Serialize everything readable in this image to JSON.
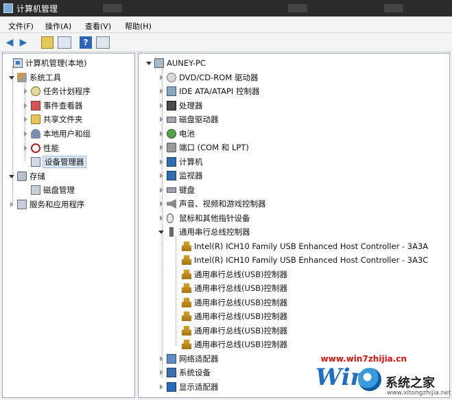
{
  "window": {
    "title": "计算机管理"
  },
  "menu": {
    "items": [
      "文件(F)",
      "操作(A)",
      "查看(V)",
      "帮助(H)"
    ]
  },
  "toolbar": {
    "buttons": [
      "back-arrow-icon",
      "forward-arrow-icon",
      "up-folder-icon",
      "show-hide-tree-icon",
      "help-icon",
      "properties-icon"
    ]
  },
  "left_tree": {
    "root": "计算机管理(本地)",
    "system_tools": "系统工具",
    "task_scheduler": "任务计划程序",
    "event_viewer": "事件查看器",
    "shared_folders": "共享文件夹",
    "local_users": "本地用户和组",
    "performance": "性能",
    "device_manager": "设备管理器",
    "storage": "存储",
    "disk_management": "磁盘管理",
    "services_apps": "服务和应用程序"
  },
  "right_tree": {
    "root": "AUNEY-PC",
    "items": [
      "DVD/CD-ROM 驱动器",
      "IDE ATA/ATAPI 控制器",
      "处理器",
      "磁盘驱动器",
      "电池",
      "端口 (COM 和 LPT)",
      "计算机",
      "监视器",
      "键盘",
      "声音、视频和游戏控制器",
      "鼠标和其他指针设备",
      "通用串行总线控制器"
    ],
    "usb_children": [
      "Intel(R) ICH10 Family USB Enhanced Host Controller - 3A3A",
      "Intel(R) ICH10 Family USB Enhanced Host Controller - 3A3C",
      "通用串行总线(USB)控制器",
      "通用串行总线(USB)控制器",
      "通用串行总线(USB)控制器",
      "通用串行总线(USB)控制器",
      "通用串行总线(USB)控制器",
      "通用串行总线(USB)控制器"
    ],
    "after_usb": [
      "网络适配器",
      "系统设备",
      "显示适配器"
    ]
  },
  "watermark": {
    "url": "www.win7zhijia.cn",
    "logo": "Win",
    "brand": "系统之家",
    "sub": "www.xitongzhijia.net"
  }
}
